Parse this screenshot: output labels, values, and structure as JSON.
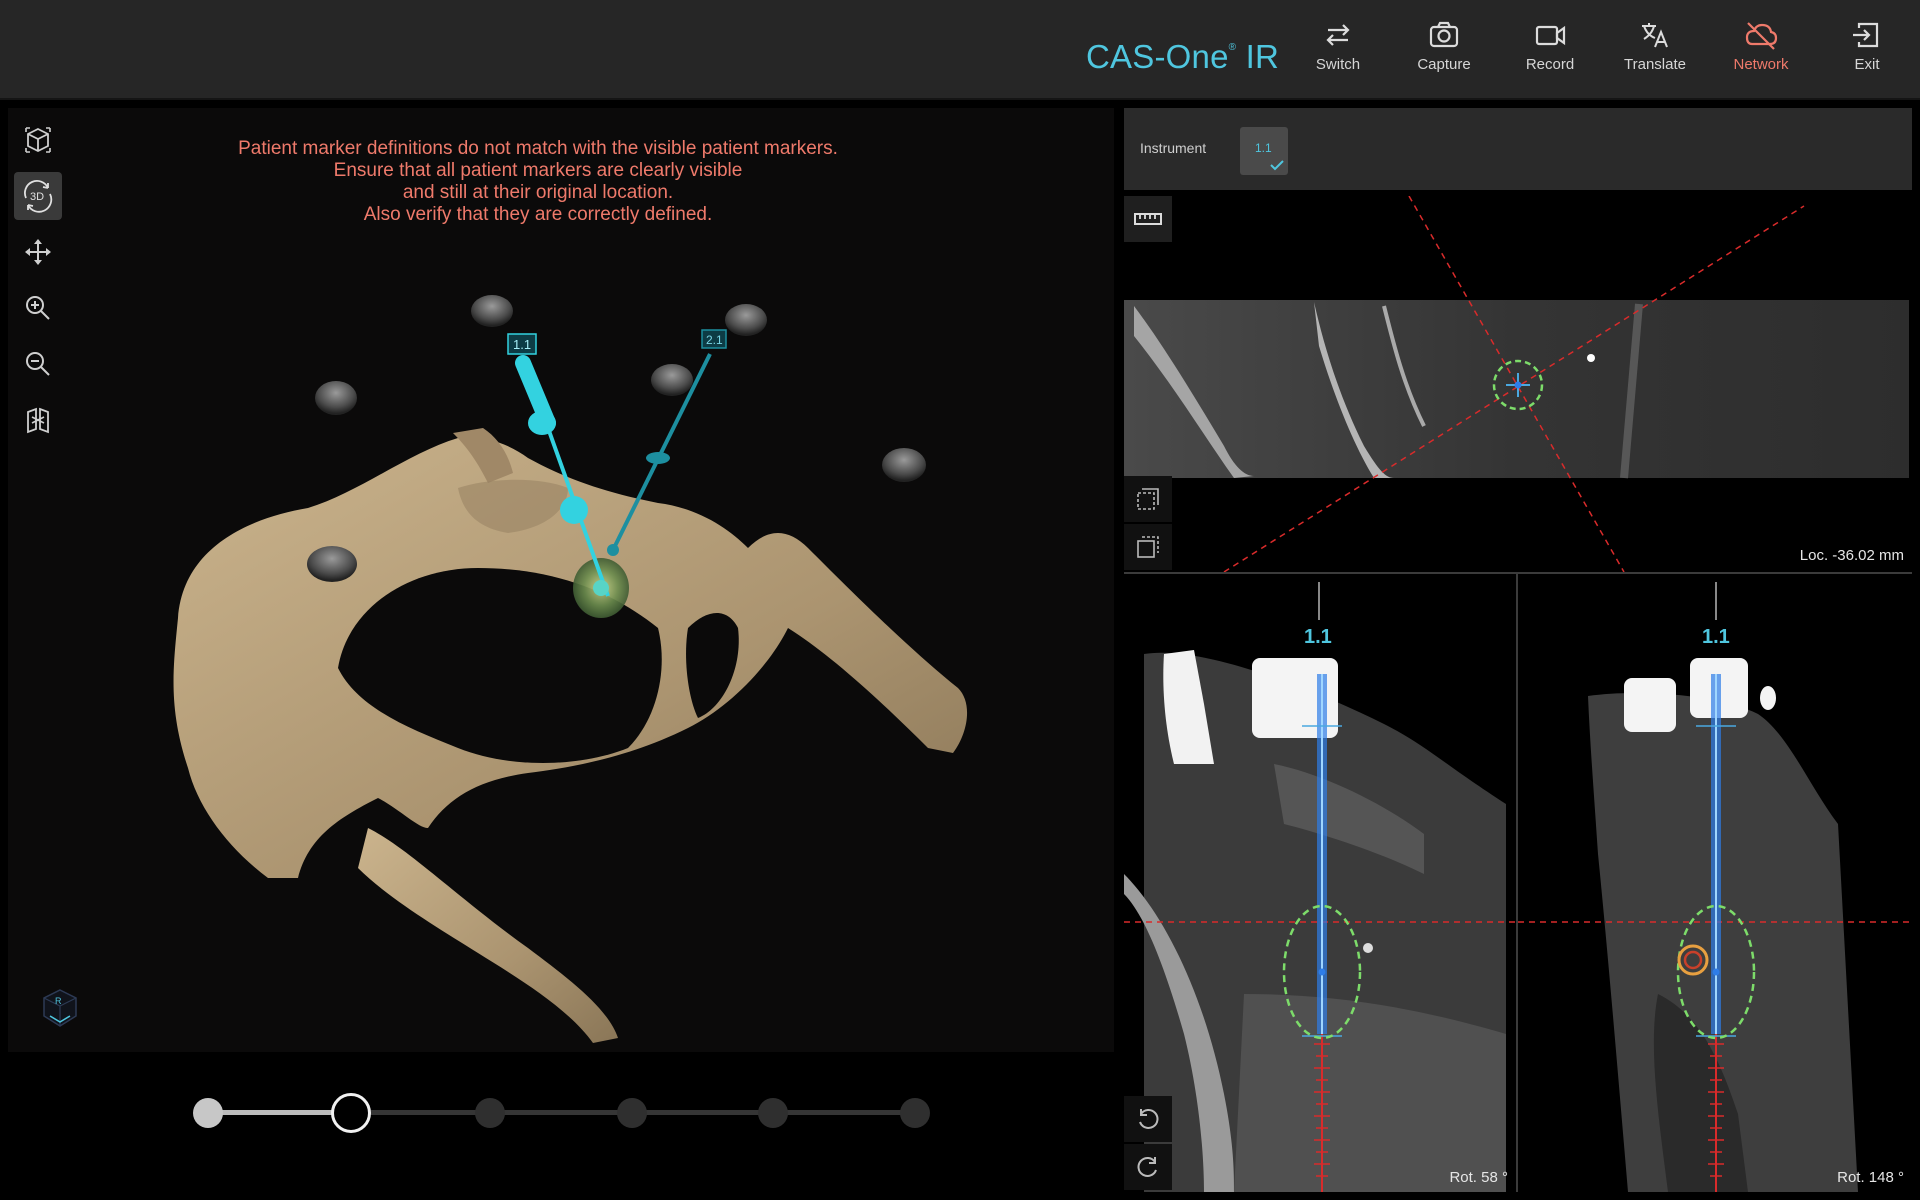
{
  "app": {
    "brand": "CAS-One",
    "brand_mark": "®",
    "brand_suffix": "IR"
  },
  "toolbar": {
    "switch_label": "Switch",
    "capture_label": "Capture",
    "record_label": "Record",
    "translate_label": "Translate",
    "network_label": "Network",
    "exit_label": "Exit"
  },
  "warning": {
    "lines": [
      "Patient marker definitions do not match with the visible patient markers.",
      "Ensure that all patient markers are clearly visible",
      "and still at their original location.",
      "Also verify that they are correctly defined."
    ]
  },
  "view3d": {
    "tools": [
      "view-cube-icon",
      "rotate-3d-icon",
      "pan-icon",
      "zoom-in-icon",
      "zoom-out-icon",
      "reset-view-icon"
    ],
    "trajectory_labels": [
      "1.1",
      "2.1"
    ]
  },
  "instrument": {
    "label": "Instrument",
    "selected": "1.1"
  },
  "slices": {
    "axial_readout": "Loc. -36.02 mm",
    "sagittal_label": "1.1",
    "sagittal_readout": "Rot. 58 °",
    "coronal_label": "1.1",
    "coronal_readout": "Rot. 148 °"
  },
  "workflow": {
    "total_steps": 6,
    "current_step": 2
  },
  "colors": {
    "accent": "#4fc6df",
    "warning": "#ef7a6b",
    "bone": "#b9a27e",
    "target": "#8fe06a"
  }
}
